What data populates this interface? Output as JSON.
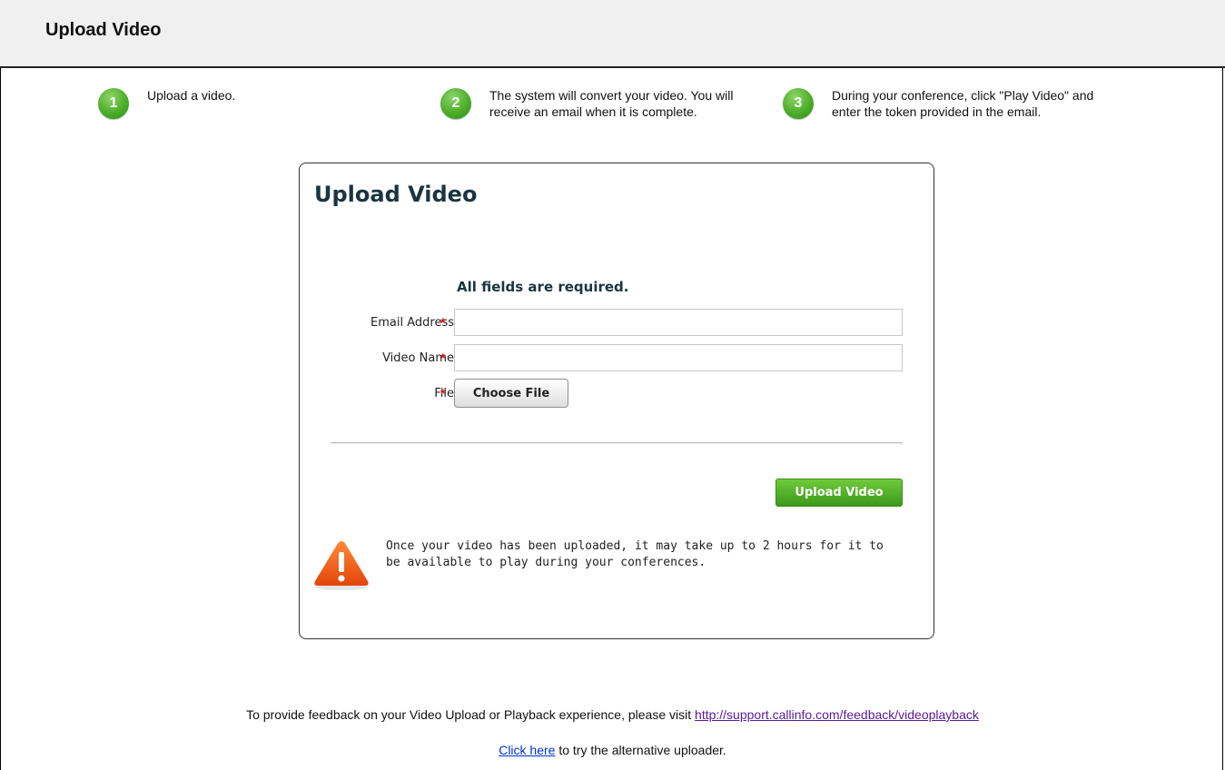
{
  "header": {
    "title": "Upload Video"
  },
  "steps": [
    {
      "number": "1",
      "text": "Upload a video."
    },
    {
      "number": "2",
      "text": "The system will convert your video. You will receive an email when it is complete."
    },
    {
      "number": "3",
      "text": "During your conference, click \"Play Video\" and enter the token provided in the email."
    }
  ],
  "form": {
    "title": "Upload Video",
    "required_note": "All fields are required.",
    "required_marker": "*",
    "fields": [
      {
        "label": "Email Address",
        "value": "",
        "placeholder": ""
      },
      {
        "label": "Video Name",
        "value": "",
        "placeholder": ""
      },
      {
        "label": "File",
        "button_label": "Choose File"
      }
    ],
    "submit_label": "Upload Video",
    "notice": "Once your video has been uploaded, it may take up to 2 hours for it to be available to play during your conferences."
  },
  "footer": {
    "feedback_prefix": "To provide feedback on your Video Upload or Playback experience, please visit ",
    "feedback_link": "http://support.callinfo.com/feedback/videoplayback",
    "alt_link": "Click here",
    "alt_suffix": " to try the alternative uploader."
  },
  "colors": {
    "accent_green": "#4cae2a",
    "warning_orange": "#f05a10",
    "link_blue": "#0033cc",
    "link_visited": "#5a1a9a"
  }
}
